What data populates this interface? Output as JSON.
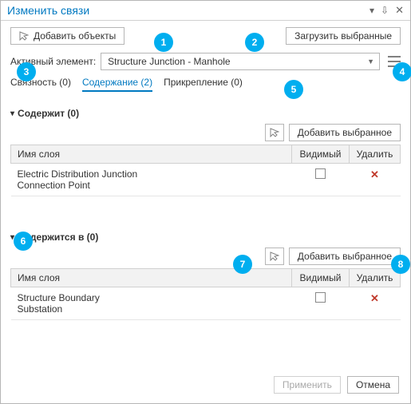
{
  "window": {
    "title": "Изменить связи"
  },
  "toolbar": {
    "add_objects_label": "Добавить объекты",
    "load_selected_label": "Загрузить выбранные"
  },
  "active_element": {
    "label": "Активный элемент:",
    "value": "Structure Junction - Manhole"
  },
  "tabs": {
    "connectivity": "Связность (0)",
    "containment": "Содержание (2)",
    "attachment": "Прикрепление (0)"
  },
  "columns": {
    "layer_name": "Имя слоя",
    "visible": "Видимый",
    "delete": "Удалить"
  },
  "sections": {
    "contains": {
      "title": "Содержит (0)",
      "add_selected_label": "Добавить выбранное",
      "rows": [
        {
          "line1": "Electric Distribution Junction",
          "line2": "Connection Point"
        }
      ]
    },
    "contained_in": {
      "title": "Содержится в (0)",
      "add_selected_label": "Добавить выбранное",
      "rows": [
        {
          "line1": "Structure Boundary",
          "line2": "Substation"
        }
      ]
    }
  },
  "footer": {
    "apply_label": "Применить",
    "cancel_label": "Отмена"
  },
  "callouts": {
    "1": "1",
    "2": "2",
    "3": "3",
    "4": "4",
    "5": "5",
    "6": "6",
    "7": "7",
    "8": "8"
  }
}
